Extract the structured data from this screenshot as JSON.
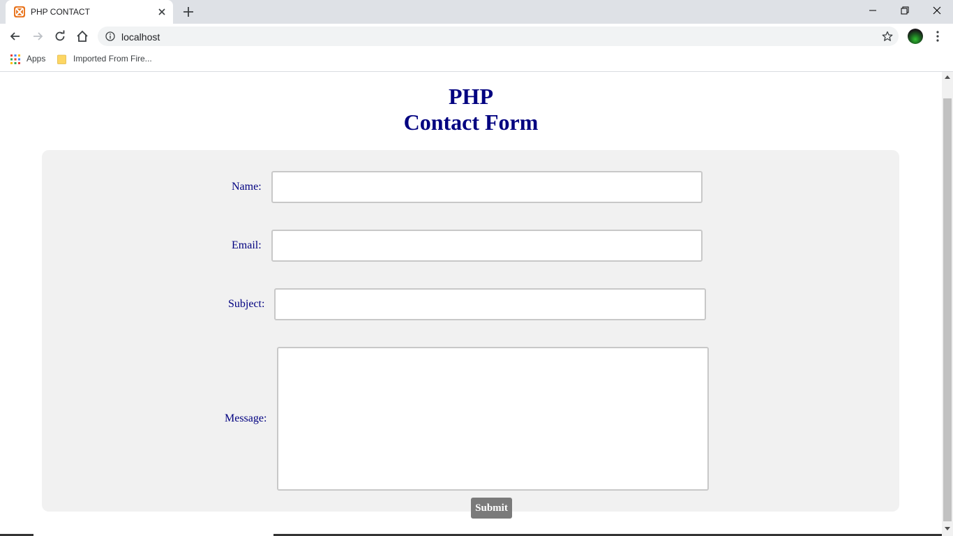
{
  "browser": {
    "tab_title": "PHP CONTACT",
    "url": "localhost",
    "bookmarks": [
      {
        "label": "Apps",
        "icon": "apps-grid-icon"
      },
      {
        "label": "Imported From Fire...",
        "icon": "folder-icon"
      }
    ]
  },
  "page": {
    "title_line1": "PHP",
    "title_line2": "Contact Form"
  },
  "form": {
    "name_label": "Name:",
    "name_value": "",
    "email_label": "Email:",
    "email_value": "",
    "subject_label": "Subject:",
    "subject_value": "",
    "message_label": "Message:",
    "message_value": "",
    "submit_label": "Submit"
  },
  "colors": {
    "heading": "#000080",
    "panel": "#f1f1f1",
    "submit": "#7a7a7a",
    "tab_strip": "#dee1e6"
  }
}
